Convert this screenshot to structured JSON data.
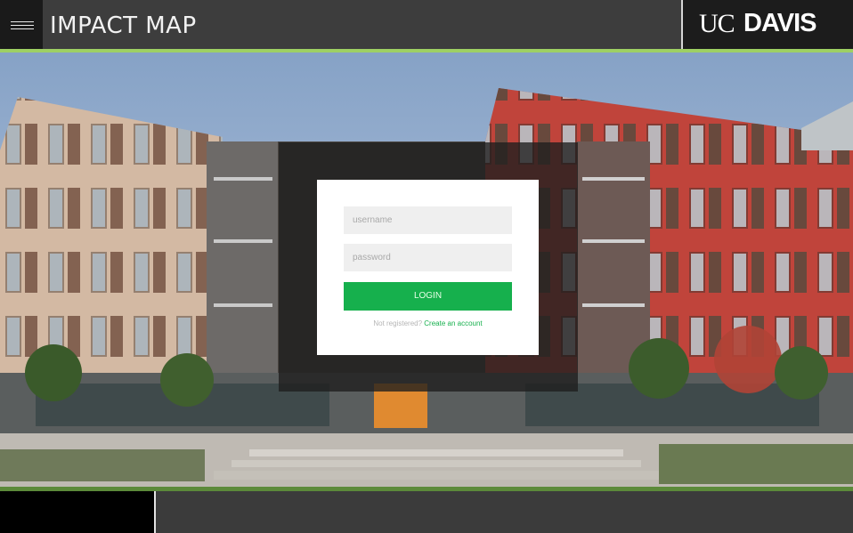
{
  "header": {
    "title": "IMPACT MAP",
    "menu_icon": "hamburger-menu-icon",
    "logo_uc": "UC",
    "logo_davis": "DAVIS"
  },
  "colors": {
    "accent": "#9ed064",
    "login_button": "#16b04d",
    "header_bg": "#3d3d3d",
    "logo_bg": "#1c1c1c"
  },
  "login": {
    "username_placeholder": "username",
    "password_placeholder": "password",
    "login_label": "LOGIN",
    "register_prompt": "Not registered?",
    "register_link": "Create an account"
  }
}
